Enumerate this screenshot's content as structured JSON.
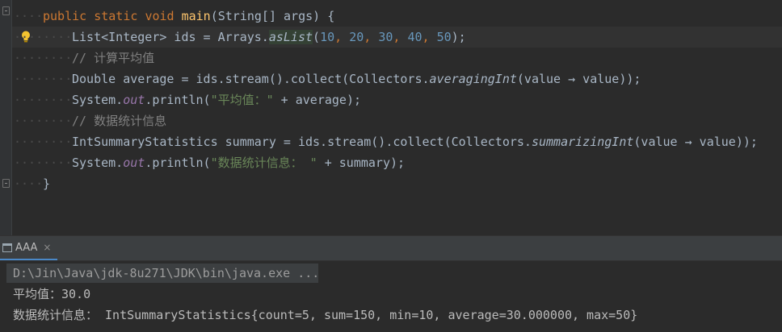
{
  "editor": {
    "lines": [
      {
        "parts": [
          "public",
          "static",
          "void",
          "main",
          "(String[] args) {"
        ]
      },
      {
        "parts": [
          "List<Integer> ids = Arrays.",
          "asList",
          "(",
          "10",
          ", ",
          "20",
          ", ",
          "30",
          ", ",
          "40",
          ", ",
          "50",
          ");"
        ]
      },
      {
        "comment": "// 计算平均值"
      },
      {
        "parts": [
          "Double average = ids.stream().collect(Collectors.",
          "averagingInt",
          "(value ",
          "→",
          " value));"
        ]
      },
      {
        "parts": [
          "System.",
          "out",
          ".println(",
          "\"平均值：\"",
          " + average);"
        ]
      },
      {
        "comment": "// 数据统计信息"
      },
      {
        "parts": [
          "IntSummaryStatistics summary = ids.stream().collect(Collectors.",
          "summarizingInt",
          "(value ",
          "→",
          " value));"
        ]
      },
      {
        "parts": [
          "System.",
          "out",
          ".println(",
          "\"数据统计信息： \"",
          " + summary);"
        ]
      },
      {
        "close": "}"
      }
    ]
  },
  "run_panel": {
    "tab_label": "AAA",
    "close_glyph": "×",
    "icon": "run-window-icon"
  },
  "console": {
    "command": "D:\\Jin\\Java\\jdk-8u271\\JDK\\bin\\java.exe ...",
    "output": [
      "平均值：30.0",
      "数据统计信息： IntSummaryStatistics{count=5, sum=150, min=10, average=30.000000, max=50}"
    ]
  },
  "colors": {
    "background": "#2b2b2b",
    "keyword": "#cc7832",
    "method": "#ffc66d",
    "number": "#6897bb",
    "string": "#6a8759",
    "comment": "#808080",
    "field": "#9876aa",
    "text": "#a9b7c6"
  }
}
